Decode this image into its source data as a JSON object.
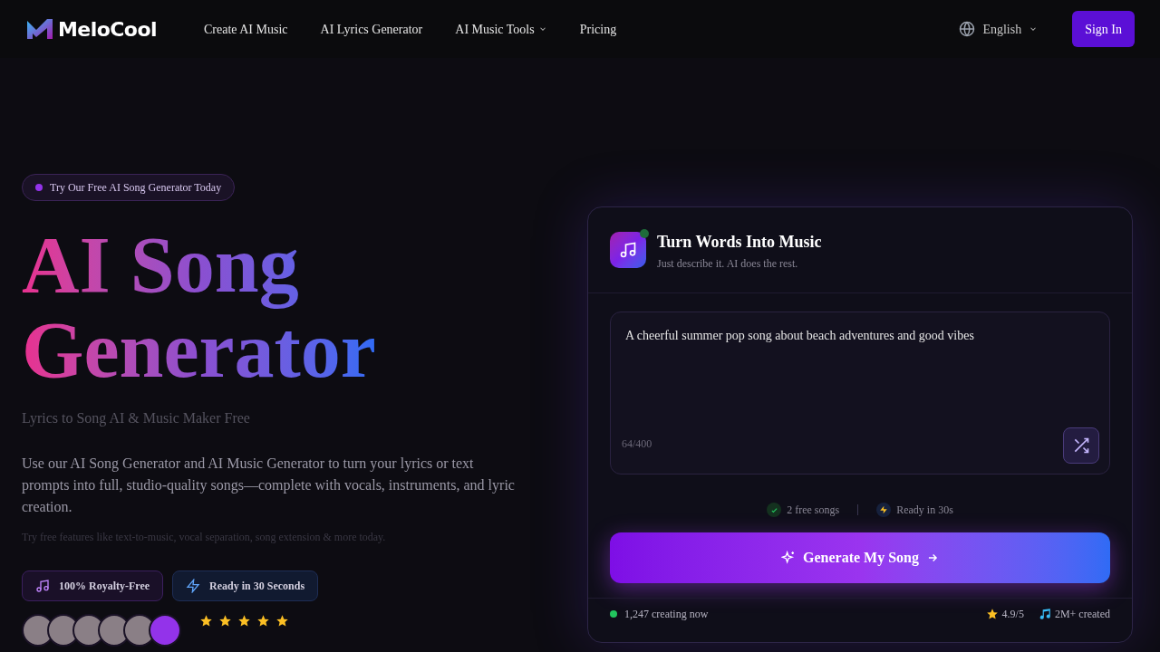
{
  "header": {
    "logo_text": "MeloCool",
    "nav": [
      {
        "label": "Create AI Music",
        "dropdown": false
      },
      {
        "label": "AI Lyrics Generator",
        "dropdown": false
      },
      {
        "label": "AI Music Tools",
        "dropdown": true
      },
      {
        "label": "Pricing",
        "dropdown": false
      }
    ],
    "language": "English",
    "sign_in": "Sign In"
  },
  "hero": {
    "badge": "Try Our Free AI Song Generator Today",
    "title_lines": [
      "AI Song",
      "Generator"
    ],
    "subtitle": "Lyrics to Song AI & Music Maker Free",
    "description": "Use our AI Song Generator and AI Music Generator to turn your lyrics or text prompts into full, studio-quality songs—complete with vocals, instruments, and lyric creation.",
    "note": "Try free features like text-to-music, vocal separation, song extension & more today.",
    "features": [
      {
        "kind": "music",
        "label": "100% Royalty-Free"
      },
      {
        "kind": "bolt",
        "label": "Ready in 30 Seconds"
      }
    ],
    "avatars": [
      {
        "kind": "photo"
      },
      {
        "kind": "photo"
      },
      {
        "kind": "photo"
      },
      {
        "kind": "photo"
      },
      {
        "kind": "photo"
      },
      {
        "kind": "more"
      }
    ],
    "stars": 5
  },
  "card": {
    "title": "Turn Words Into Music",
    "subtitle": "Just describe it. AI does the rest.",
    "prompt": {
      "value": "A cheerful summer pop song about beach adventures and good vibes",
      "counter": "64/400"
    },
    "perks": [
      {
        "kind": "check",
        "label": "2 free songs"
      },
      {
        "kind": "bolt",
        "label": "Ready in 30s"
      }
    ],
    "generate_button": "Generate My Song",
    "live": "1,247 creating now",
    "rating": "4.9/5",
    "created": "2M+ created"
  }
}
